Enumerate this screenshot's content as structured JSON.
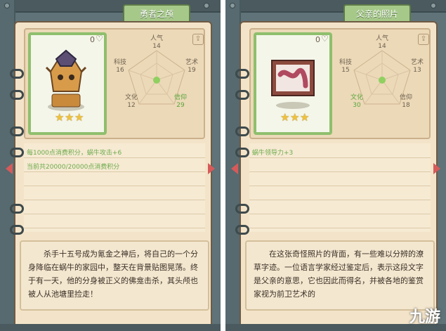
{
  "left_panel": {
    "tab_title": "勇者之颅",
    "count": "0",
    "stars": 3,
    "stats": {
      "renqi_label": "人气",
      "renqi_value": "14",
      "keji_label": "科技",
      "keji_value": "16",
      "yishu_label": "艺术",
      "yishu_value": "19",
      "wenhua_label": "文化",
      "wenhua_value": "12",
      "xinyang_label": "信仰",
      "xinyang_value": "29"
    },
    "effects": [
      "每1000点消费积分，蜗牛攻击+6",
      "当前共20000/20000点消费积分"
    ],
    "description": "杀手十五号成为氪金之神后，将自己的一个分身降临在蜗牛的家园中，整天在背景贴图晃荡。终于有一天，他的分身被正义的佛龛击杀，其头颅也被人从池塘里捡走！"
  },
  "right_panel": {
    "tab_title": "父亲的照片",
    "count": "0",
    "stars": 3,
    "stats": {
      "renqi_label": "人气",
      "renqi_value": "14",
      "keji_label": "科技",
      "keji_value": "15",
      "yishu_label": "艺术",
      "yishu_value": "13",
      "wenhua_label": "文化",
      "wenhua_value": "30",
      "xinyang_label": "信仰",
      "xinyang_value": "18"
    },
    "effects": [
      "蜗牛领导力+3"
    ],
    "description": "在这张奇怪照片的背面，有一些难以分辨的潦草字迹。一位语言学家经过鉴定后，表示这段文字是父亲的意思，它也因此而得名，并被各地的鉴赏家视为前卫艺术的"
  },
  "watermark": "九游",
  "icons": {
    "share": "share-icon",
    "heart": "heart-icon",
    "prev": "arrow-left-icon",
    "next": "arrow-right-icon",
    "star": "star-icon"
  },
  "colors": {
    "accent_green": "#5aa63c",
    "paper": "#f3e4c9",
    "arrow_red": "#d65a5a",
    "star_gold": "#f0c23a"
  }
}
